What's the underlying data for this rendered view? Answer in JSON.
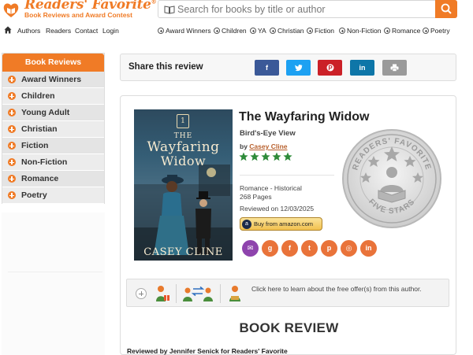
{
  "header": {
    "logo_title": "Readers' Favorite",
    "logo_subtitle": "Book Reviews and Award Contest",
    "logo_trademark": "®",
    "search_placeholder": "Search for books by title or author",
    "search_icon": "search-icon",
    "book_icon": "book-icon"
  },
  "topnav": {
    "links": [
      "Authors",
      "Readers",
      "Contact",
      "Login"
    ],
    "genres": [
      "Award Winners",
      "Children",
      "YA",
      "Christian",
      "Fiction",
      "Non-Fiction",
      "Romance",
      "Poetry"
    ]
  },
  "sidebar": {
    "heading": "Book Reviews",
    "items": [
      "Award Winners",
      "Children",
      "Young Adult",
      "Christian",
      "Fiction",
      "Non-Fiction",
      "Romance",
      "Poetry"
    ]
  },
  "share": {
    "title": "Share this review",
    "buttons": [
      {
        "name": "facebook",
        "glyph": "f",
        "color": "#3b5998"
      },
      {
        "name": "twitter",
        "glyph": "🐦",
        "color": "#1da1f2"
      },
      {
        "name": "pinterest",
        "glyph": "P",
        "color": "#cb2027"
      },
      {
        "name": "linkedin",
        "glyph": "in",
        "color": "#0e76a8"
      },
      {
        "name": "print",
        "glyph": "⎙",
        "color": "#8e8e8e"
      }
    ]
  },
  "book": {
    "cover": {
      "series_number": "1",
      "title_the": "THE",
      "title_line1": "Wayfaring",
      "title_line2": "Widow",
      "author": "CASEY CLINE"
    },
    "title": "The Wayfaring Widow",
    "subtitle": "Bird's-Eye View",
    "by_label": "by",
    "author": "Casey Cline",
    "rating_stars": 5,
    "star_color": "#2e8b3a",
    "genre": "Romance - Historical",
    "pages": "268 Pages",
    "reviewed_on": "Reviewed on 12/03/2025",
    "amazon_label": "Buy from amazon.com",
    "seal": {
      "top_text": "READERS' FAVORITE",
      "bottom_text": "FIVE STARS"
    },
    "social_icons": [
      {
        "name": "email",
        "glyph": "✉",
        "color": "#8e44ad"
      },
      {
        "name": "goodreads",
        "glyph": "g",
        "color": "#e9733a"
      },
      {
        "name": "facebook",
        "glyph": "f",
        "color": "#e9733a"
      },
      {
        "name": "twitter",
        "glyph": "t",
        "color": "#e9733a"
      },
      {
        "name": "pinterest",
        "glyph": "p",
        "color": "#e9733a"
      },
      {
        "name": "instagram",
        "glyph": "◎",
        "color": "#e9733a"
      },
      {
        "name": "linkedin",
        "glyph": "in",
        "color": "#e9733a"
      }
    ]
  },
  "offers": {
    "text": "Click here to learn about the free offer(s) from this author."
  },
  "review": {
    "heading": "BOOK REVIEW",
    "reviewed_by": "Reviewed by Jennifer Senick for Readers' Favorite"
  },
  "colors": {
    "brand_orange": "#f07b26",
    "star_green": "#2e8b3a"
  }
}
